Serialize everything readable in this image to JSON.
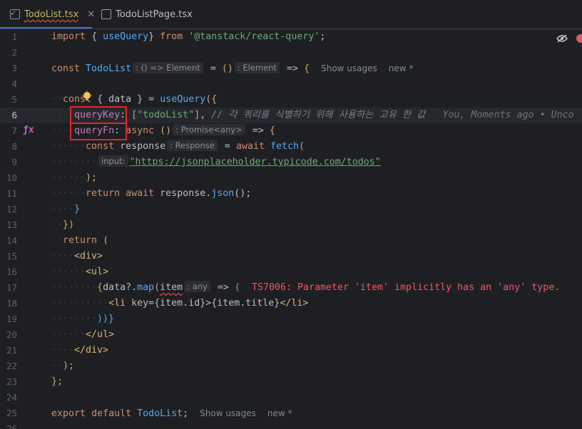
{
  "tabs": [
    {
      "label": "TodoList.tsx",
      "close": "✕"
    },
    {
      "label": "TodoListPage.tsx"
    }
  ],
  "gutter": {
    "line_numbers": [
      "1",
      "2",
      "3",
      "4",
      "5",
      "6",
      "7",
      "8",
      "9",
      "10",
      "11",
      "12",
      "13",
      "14",
      "15",
      "16",
      "17",
      "18",
      "19",
      "20",
      "21",
      "22",
      "23",
      "24",
      "25",
      "26"
    ]
  },
  "code": {
    "l1": {
      "import": "import",
      "lb": "{",
      "useQuery": "useQuery",
      "rb": "}",
      "from": "from",
      "module": "'@tanstack/react-query'",
      "semi": ";"
    },
    "l3": {
      "const": "const",
      "name": "TodoList",
      "hint": ": () => Element",
      "eq": "=",
      "parens": "()",
      "hint2": ": Element",
      "arrow": "=>",
      "brace": "{",
      "usages": "Show usages",
      "new": "new *"
    },
    "l5": {
      "const": "const",
      "lb": "{",
      "data": "data",
      "rb": "}",
      "eq": "=",
      "fn": "useQuery",
      "open": "({"
    },
    "l6": {
      "key": "queryKey",
      "colon": ":",
      "lb": "[",
      "str": "\"todoList\"",
      "rb": "]",
      "comma": ",",
      "comment": "// 각 쿼리를 식별하기 위해 사용하는 고유 한 값",
      "blame": "You, Moments ago • Unco"
    },
    "l7": {
      "key": "queryFn",
      "colon": ":",
      "async": "async",
      "parens": "()",
      "hint": ": Promise<any>",
      "arrow": "=>",
      "brace": "{"
    },
    "l8": {
      "const": "const",
      "name": "response",
      "hint": ": Response",
      "eq": "=",
      "await": "await",
      "fn": "fetch",
      "open": "("
    },
    "l9": {
      "hint": "input:",
      "url": "\"https://jsonplaceholder.typicode.com/todos\""
    },
    "l10": {
      "close": ");"
    },
    "l11": {
      "return": "return",
      "await": "await",
      "obj": "response",
      "dot": ".",
      "fn": "json",
      "call": "();"
    },
    "l12": {
      "close": "}"
    },
    "l13": {
      "close": "})"
    },
    "l14": {
      "return": "return",
      "paren": "("
    },
    "l15": {
      "tag": "<div>"
    },
    "l16": {
      "tag": "<ul>"
    },
    "l17": {
      "lb": "{",
      "data": "data",
      "opt": "?.",
      "fn": "map",
      "open": "(",
      "item": "item",
      "hint": ": any",
      "arrow": "=>",
      "paren": "(",
      "error": "TS7006: Parameter 'item' implicitly has an 'any' type."
    },
    "l18": {
      "open": "<li",
      "attr": "key",
      "eq": "=",
      "expr1": "{item.id}",
      "gt": ">",
      "expr2": "{item.title}",
      "close": "</li>"
    },
    "l19": {
      "close": "))}"
    },
    "l20": {
      "tag": "</ul>"
    },
    "l21": {
      "tag": "</div>"
    },
    "l22": {
      "close": ");"
    },
    "l23": {
      "close": "};"
    },
    "l25": {
      "export": "export",
      "default": "default",
      "name": "TodoList",
      "semi": ";",
      "usages": "Show usages",
      "new": "new *"
    }
  },
  "colors": {
    "highlight_box": "#e3262b",
    "accent": "#3574f0"
  },
  "icons": {
    "tab1": "tsx-file-check-icon",
    "tab2": "tsx-file-icon",
    "bulb": "lightbulb-icon",
    "gutter": "implementation-icon",
    "reader": "eye-crossed-icon",
    "errors": "error-indicator-icon"
  }
}
